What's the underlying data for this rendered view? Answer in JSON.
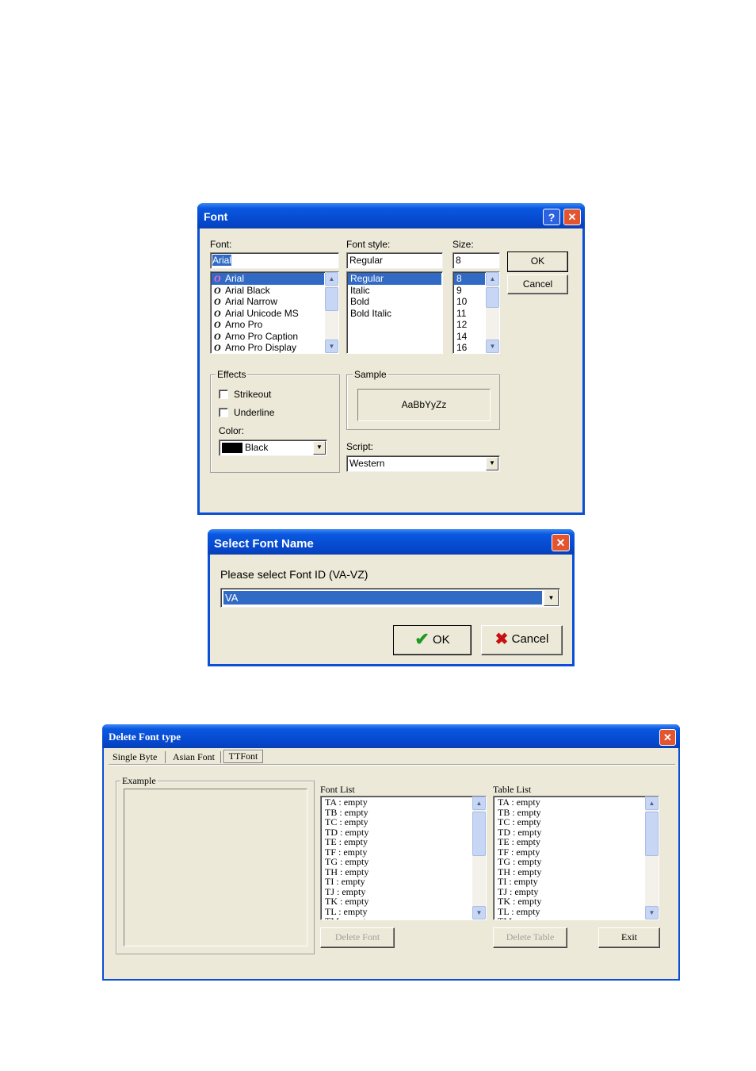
{
  "font_dialog": {
    "title": "Font",
    "help_button": "?",
    "close_button": "✕",
    "font_label": "Font:",
    "font_value": "Arial",
    "font_list": [
      "Arial",
      "Arial Black",
      "Arial Narrow",
      "Arial Unicode MS",
      "Arno Pro",
      "Arno Pro Caption",
      "Arno Pro Display"
    ],
    "font_selected": "Arial",
    "style_label": "Font style:",
    "style_value": "Regular",
    "style_list": [
      "Regular",
      "Italic",
      "Bold",
      "Bold Italic"
    ],
    "style_selected": "Regular",
    "size_label": "Size:",
    "size_value": "8",
    "size_list": [
      "8",
      "9",
      "10",
      "11",
      "12",
      "14",
      "16"
    ],
    "size_selected": "8",
    "ok_label": "OK",
    "cancel_label": "Cancel",
    "effects_label": "Effects",
    "strikeout_label": "Strikeout",
    "underline_label": "Underline",
    "color_label": "Color:",
    "color_value": "Black",
    "color_swatch": "#000000",
    "sample_label": "Sample",
    "sample_text": "AaBbYyZz",
    "script_label": "Script:",
    "script_value": "Western",
    "font_type_icon": "opentype-icon"
  },
  "select_font_dialog": {
    "title": "Select Font Name",
    "close_button": "✕",
    "prompt": "Please select Font ID (VA-VZ)",
    "selected_value": "VA",
    "ok_label": "OK",
    "cancel_label": "Cancel",
    "ok_icon": "checkmark-icon",
    "cancel_icon": "red-x-icon"
  },
  "delete_font_dialog": {
    "title": "Delete Font type",
    "close_button": "✕",
    "tabs": [
      "Single Byte",
      "Asian Font",
      "TTFont"
    ],
    "active_tab": "TTFont",
    "example_label": "Example",
    "font_list_label": "Font List",
    "table_list_label": "Table List",
    "font_list": [
      "TA : empty",
      "TB : empty",
      "TC : empty",
      "TD : empty",
      "TE : empty",
      "TF : empty",
      "TG : empty",
      "TH : empty",
      "TI : empty",
      "TJ : empty",
      "TK : empty",
      "TL : empty",
      "TM : empty"
    ],
    "table_list": [
      "TA : empty",
      "TB : empty",
      "TC : empty",
      "TD : empty",
      "TE : empty",
      "TF : empty",
      "TG : empty",
      "TH : empty",
      "TI : empty",
      "TJ : empty",
      "TK : empty",
      "TL : empty",
      "TM : empty"
    ],
    "delete_font_label": "Delete Font",
    "delete_table_label": "Delete Table",
    "exit_label": "Exit"
  },
  "colors": {
    "xp_titlebar": "#0a58e0",
    "selection": "#316ac5",
    "dialog_face": "#ece9d8"
  }
}
